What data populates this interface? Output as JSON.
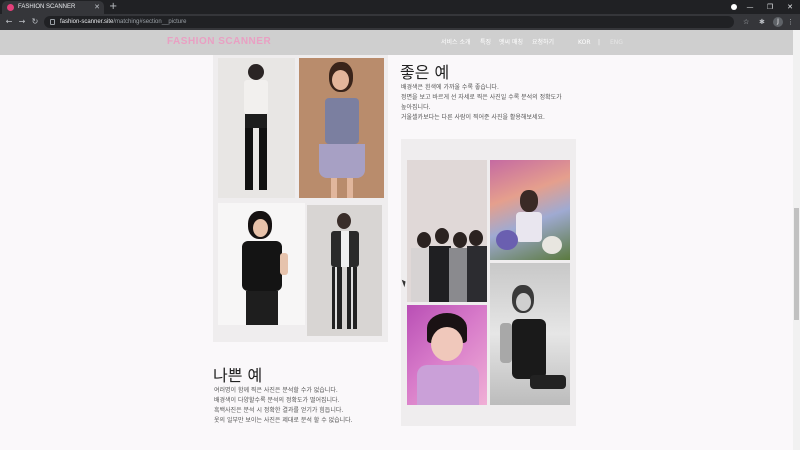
{
  "browser": {
    "tab_title": "FASHION SCANNER",
    "url_domain": "fashion-scanner.site",
    "url_path": "/matching#section__picture",
    "avatar_letter": "J"
  },
  "site": {
    "logo": "FASHION SCANNER",
    "nav": [
      "서비스 소개",
      "특징",
      "엣씨 매칭",
      "요청하기"
    ],
    "lang_active": "KOR",
    "lang_separator": "|",
    "lang_inactive": "ENG"
  },
  "good": {
    "title": "좋은 예",
    "lines": [
      "배경색은 흰색에 가까울 수록 좋습니다.",
      "정면을 보고 바르게 선 자세로 찍은 사진일 수록 분석의 정확도가",
      "높아집니다.",
      "거울셀카보다는 다른 사람이 찍어준 사진을 활용해보세요."
    ]
  },
  "bad": {
    "title": "나쁜 예",
    "lines": [
      "여러명이 함께 찍은 사진은 분석할 수가 없습니다.",
      "배경색이 다양할수록 분석의 정확도가 떨어집니다.",
      "흑백사진은 분석 시 정확한 결과를 얻기가 힘듭니다.",
      "옷의 일부만 보이는 사진은 제대로 분석 할 수 없습니다."
    ]
  },
  "colors": {
    "logo": "#e9a0c3",
    "header_bg": "#cfcfcf",
    "panel_bg": "#efedee"
  }
}
